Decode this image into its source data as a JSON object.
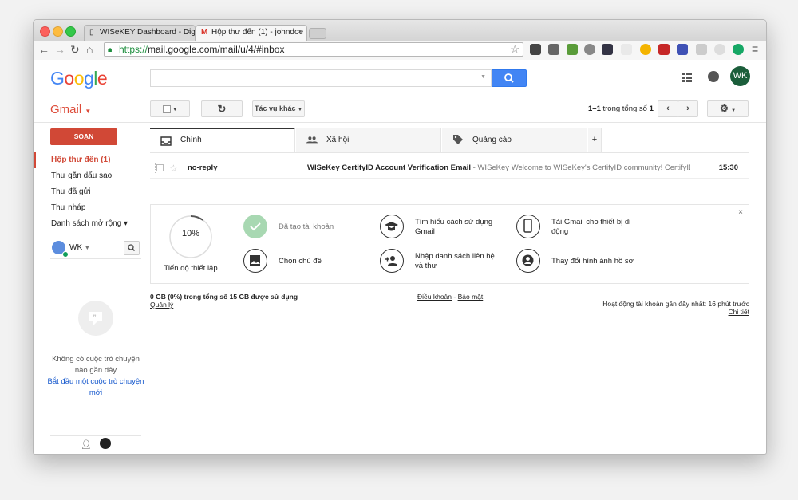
{
  "browser": {
    "tabs": [
      {
        "title": "WISeKEY Dashboard - Dig",
        "icon": "page-icon"
      },
      {
        "title": "Hộp thư đến (1) - johndoe",
        "icon": "gmail-icon"
      }
    ],
    "url_scheme": "https://",
    "url_rest": "mail.google.com/mail/u/4/#inbox"
  },
  "header": {
    "logo": "Google",
    "avatar_initials": "WK",
    "brand_blue": "#4285f4",
    "accent_red": "#d14836"
  },
  "toolbar": {
    "gmail_label": "Gmail",
    "more_label": "Tác vụ khác",
    "pager_range": "1–1",
    "pager_rest": "trong tổng số",
    "pager_total": "1"
  },
  "sidebar": {
    "compose": "SOẠN",
    "items": [
      {
        "label": "Hộp thư đến (1)",
        "active": true
      },
      {
        "label": "Thư gắn dấu sao"
      },
      {
        "label": "Thư đã gửi"
      },
      {
        "label": "Thư nháp"
      },
      {
        "label": "Danh sách mở rộng ▾"
      }
    ],
    "hangouts_user": "WK",
    "no_chats": "Không có cuộc trò chuyện nào gần đây",
    "start_chat": "Bắt đầu một cuộc trò chuyện mới"
  },
  "categories": [
    {
      "label": "Chính",
      "icon": "inbox-icon"
    },
    {
      "label": "Xã hội",
      "icon": "people-icon"
    },
    {
      "label": "Quảng cáo",
      "icon": "tag-icon"
    }
  ],
  "category_add": "+",
  "emails": [
    {
      "sender": "no-reply",
      "subject": "WISeKey CertifyID Account Verification Email",
      "snippet": " - WISeKey Welcome to WISeKey's CertifyID community! CertifyID",
      "time": "15:30"
    }
  ],
  "setup": {
    "progress": 0.1,
    "progress_label": "10%",
    "progress_caption": "Tiến độ thiết lập",
    "tasks": [
      {
        "label": "Đã tạo tài khoản",
        "done": true
      },
      {
        "label": "Tìm hiểu cách sử dụng Gmail"
      },
      {
        "label": "Tải Gmail cho thiết bị di động"
      },
      {
        "label": "Chọn chủ đề"
      },
      {
        "label": "Nhập danh sách liên hệ và thư"
      },
      {
        "label": "Thay đổi hình ảnh hồ sơ"
      }
    ],
    "close": "×"
  },
  "footer": {
    "storage": "0 GB (0%) trong tổng số 15 GB được sử dụng",
    "manage": "Quản lý",
    "terms": "Điều khoản",
    "sep": " - ",
    "privacy": "Bảo mật",
    "activity": "Hoạt động tài khoản gần đây nhất: 16 phút trước",
    "details": "Chi tiết"
  }
}
